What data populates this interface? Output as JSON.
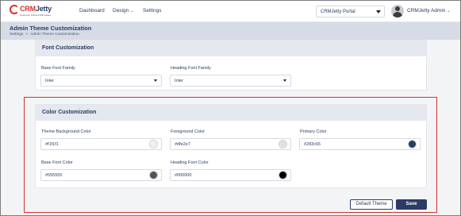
{
  "brand": {
    "logo_text_red": "CRM",
    "logo_text_blue": "Jetty",
    "logo_sub": "Customer Portal & Microsites"
  },
  "nav": {
    "dashboard": "Dashboard",
    "design": "Design",
    "settings": "Settings"
  },
  "portal_select": {
    "value": "CRMJetty Portal"
  },
  "user": {
    "name": "CRMJetty Admin"
  },
  "page": {
    "title": "Admin Theme Customization",
    "breadcrumb": [
      "Settings",
      "Admin Theme Customization"
    ],
    "breadcrumb_sep": ">"
  },
  "font_card": {
    "title": "Font Customization",
    "base_label": "Base Font Family",
    "base_value": "Inter",
    "heading_label": "Heading Font Family",
    "heading_value": "Inter"
  },
  "color_card": {
    "title": "Color Customization",
    "fields": [
      {
        "label": "Theme Background Color",
        "value": "#f1f1f1",
        "color": "#f1f1f1"
      },
      {
        "label": "Foreground Color",
        "value": "#dfe2e7",
        "color": "#dfe2e7"
      },
      {
        "label": "Primary Color",
        "value": "#283c65",
        "color": "#283c65"
      },
      {
        "label": "Base Font Color",
        "value": "#555555",
        "color": "#555555"
      },
      {
        "label": "Heading Font Color",
        "value": "#000000",
        "color": "#000000"
      }
    ]
  },
  "actions": {
    "default_theme": "Default Theme",
    "save": "Save"
  },
  "colors": {
    "primary": "#283c65",
    "highlight": "#d9302c",
    "header_band": "#d6dbe6"
  }
}
